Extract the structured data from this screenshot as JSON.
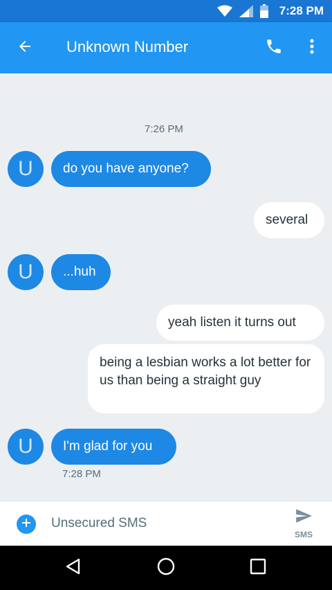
{
  "status_bar": {
    "time": "7:28 PM"
  },
  "app_bar": {
    "title": "Unknown Number"
  },
  "conversation": {
    "timestamp_top": "7:26 PM",
    "avatar_letter": "U",
    "messages": [
      {
        "direction": "incoming",
        "text": "do you have anyone?"
      },
      {
        "direction": "outgoing",
        "text": "several"
      },
      {
        "direction": "incoming",
        "text": "...huh"
      },
      {
        "direction": "outgoing",
        "text": "yeah listen it turns out"
      },
      {
        "direction": "outgoing",
        "text": "being a lesbian works a lot better for us than being a straight guy"
      },
      {
        "direction": "incoming",
        "text": "I'm glad for you"
      }
    ],
    "timestamp_bottom": "7:28 PM"
  },
  "compose": {
    "placeholder": "Unsecured SMS",
    "send_label": "SMS"
  },
  "colors": {
    "primary": "#2196f3",
    "primary_dark": "#1976d2",
    "incoming_bubble": "#1e88e5",
    "outgoing_bubble": "#ffffff",
    "background": "#eceff1"
  }
}
